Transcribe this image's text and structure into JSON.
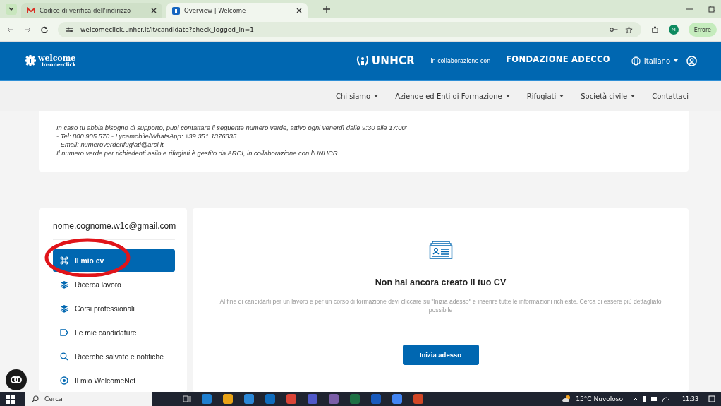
{
  "browser": {
    "tabs": [
      {
        "title": "Codice di verifica dell'indirizzo",
        "selected": false,
        "kind": "mail"
      },
      {
        "title": "Overview | Welcome",
        "selected": true,
        "kind": "site"
      }
    ],
    "address": "welcomeclick.unhcr.it/it/candidate?check_logged_in=1",
    "profile": "M",
    "status_button": "Errore"
  },
  "header": {
    "logo_title": "welcome",
    "logo_subtitle": "In-one-click",
    "partner": "UNHCR",
    "collaboration": "In collaborazione con",
    "foundation": "FONDAZIONE ADECCO",
    "language": "Italiano"
  },
  "nav": [
    {
      "label": "Chi siamo",
      "dropdown": true
    },
    {
      "label": "Aziende ed Enti di Formazione",
      "dropdown": true
    },
    {
      "label": "Rifugiati",
      "dropdown": true
    },
    {
      "label": "Società civile",
      "dropdown": true
    },
    {
      "label": "Contattaci",
      "dropdown": false
    }
  ],
  "support_lines": [
    "In caso tu abbia bisogno di supporto, puoi contattare il seguente numero verde, attivo ogni venerdì dalle 9:30 alle 17:00:",
    "- Tel: 800 905 570 - Lycamobile/WhatsApp: +39 351 1376335",
    "- Email: numeroverderifugiati@arci.it",
    "Il numero verde per richiedenti asilo e rifugiati è gestito da ARCI, in collaborazione con l'UNHCR."
  ],
  "sidebar": {
    "email": "nome.cognome.w1c@gmail.com",
    "items": [
      {
        "label": "Il mio cv",
        "selected": true,
        "kind": "command"
      },
      {
        "label": "Ricerca lavoro",
        "selected": false,
        "kind": "layers"
      },
      {
        "label": "Corsi professionali",
        "selected": false,
        "kind": "layers"
      },
      {
        "label": "Le mie candidature",
        "selected": false,
        "kind": "tag"
      },
      {
        "label": "Ricerche salvate e notifiche",
        "selected": false,
        "kind": "search"
      },
      {
        "label": "Il mio WelcomeNet",
        "selected": false,
        "kind": "target"
      }
    ]
  },
  "empty_state": {
    "title": "Non hai ancora creato il tuo CV",
    "text": "Al fine di candidarti per un lavoro e per un corso di formazione devi cliccare su \"Inizia adesso\" e inserire tutte le informazioni richieste. Cerca di essere più dettagliato possibile",
    "button": "Inizia adesso"
  },
  "taskbar": {
    "search": "Cerca",
    "weather": "15°C Nuvoloso",
    "time": "11:33"
  }
}
